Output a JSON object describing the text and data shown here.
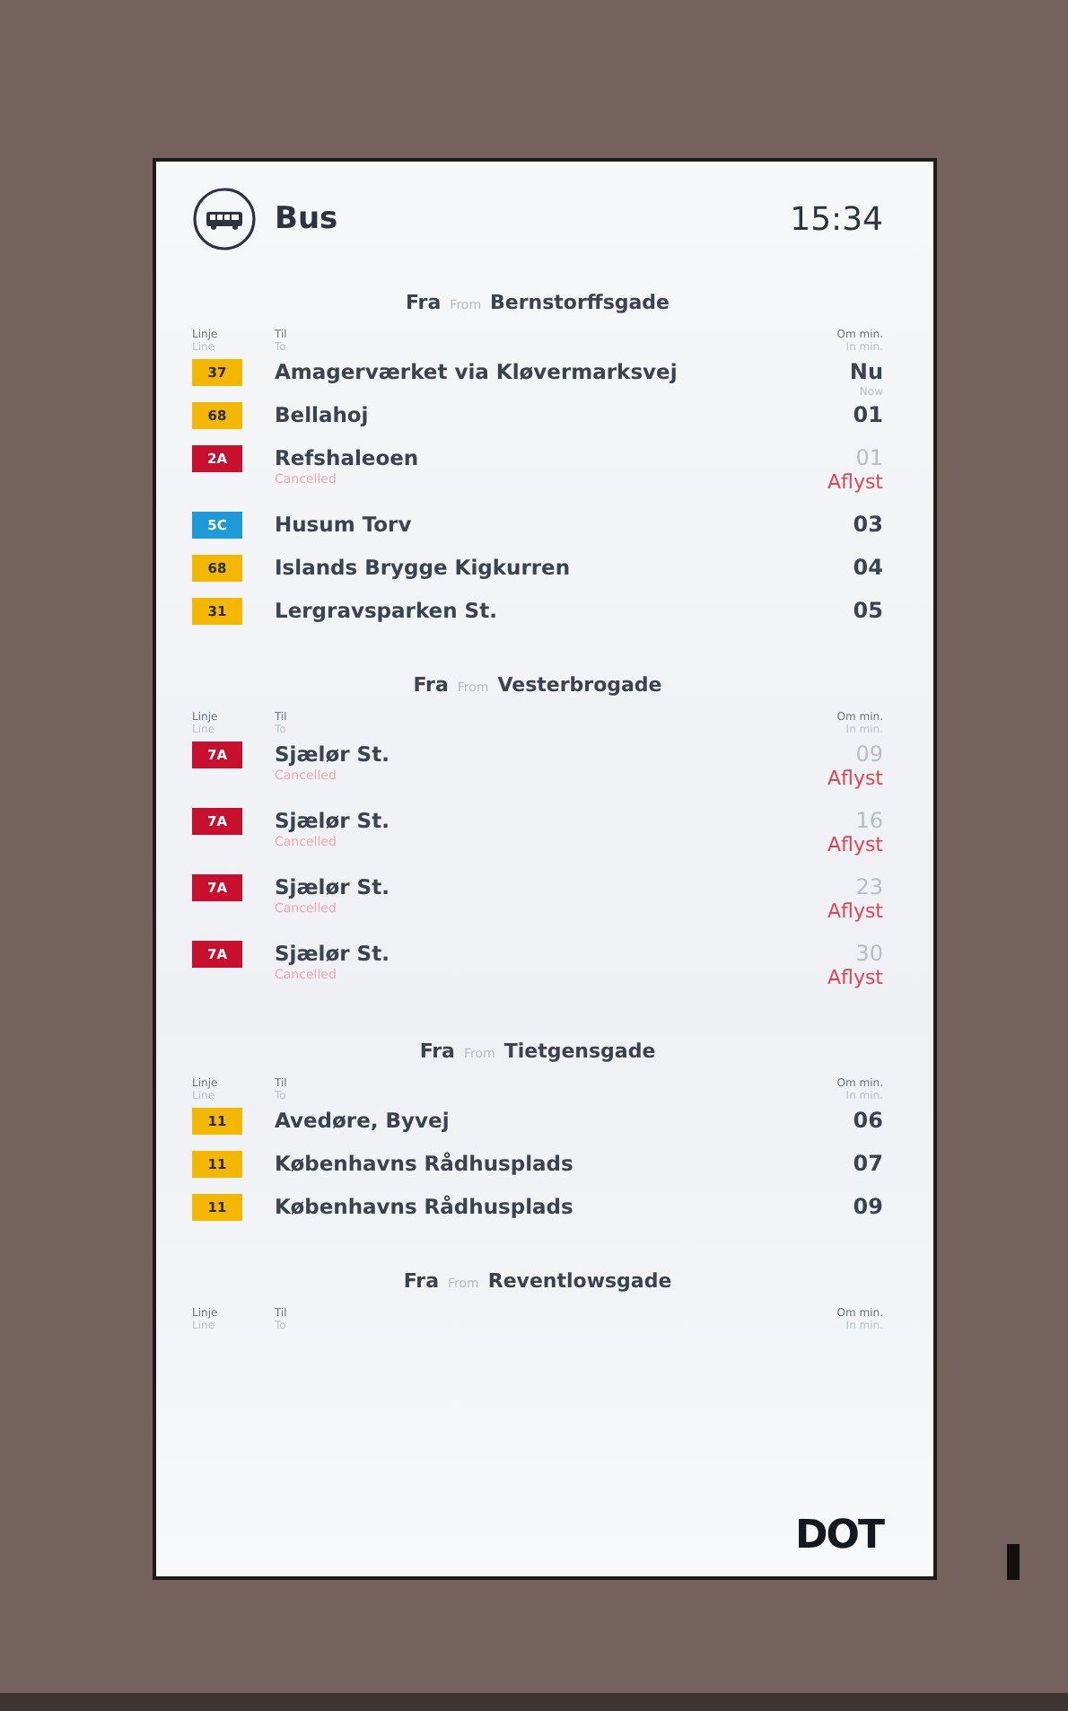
{
  "header": {
    "title": "Bus",
    "time": "15:34"
  },
  "sections": [
    {
      "from_label": "Fra",
      "from_label_en": "From",
      "stop": "Bernstorffsgade",
      "columns": {
        "line": "Linje",
        "line_en": "Line",
        "to": "Til",
        "to_en": "To",
        "minutes": "Om min.",
        "minutes_en": "In min."
      },
      "rows": [
        {
          "line": "37",
          "color": "#f5b800",
          "destination": "Amagerværket via Kløvermarksvej",
          "minutes": "Nu",
          "minutes_en": "Now",
          "cancelled": false
        },
        {
          "line": "68",
          "color": "#f5b800",
          "destination": "Bellahoj",
          "minutes": "01",
          "cancelled": false
        },
        {
          "line": "2A",
          "color": "#c8102e",
          "destination": "Refshaleoen",
          "minutes": "01",
          "cancelled": true,
          "note": "Cancelled",
          "status": "Aflyst"
        },
        {
          "line": "5C",
          "color": "#1e9ad6",
          "destination": "Husum Torv",
          "minutes": "03",
          "cancelled": false
        },
        {
          "line": "68",
          "color": "#f5b800",
          "destination": "Islands Brygge Kigkurren",
          "minutes": "04",
          "cancelled": false
        },
        {
          "line": "31",
          "color": "#f5b800",
          "destination": "Lergravsparken St.",
          "minutes": "05",
          "cancelled": false
        }
      ]
    },
    {
      "from_label": "Fra",
      "from_label_en": "From",
      "stop": "Vesterbrogade",
      "columns": {
        "line": "Linje",
        "line_en": "Line",
        "to": "Til",
        "to_en": "To",
        "minutes": "Om min.",
        "minutes_en": "In min."
      },
      "rows": [
        {
          "line": "7A",
          "color": "#c8102e",
          "destination": "Sjælør St.",
          "minutes": "09",
          "cancelled": true,
          "note": "Cancelled",
          "status": "Aflyst"
        },
        {
          "line": "7A",
          "color": "#c8102e",
          "destination": "Sjælør St.",
          "minutes": "16",
          "cancelled": true,
          "note": "Cancelled",
          "status": "Aflyst"
        },
        {
          "line": "7A",
          "color": "#c8102e",
          "destination": "Sjælør St.",
          "minutes": "23",
          "cancelled": true,
          "note": "Cancelled",
          "status": "Aflyst"
        },
        {
          "line": "7A",
          "color": "#c8102e",
          "destination": "Sjælør St.",
          "minutes": "30",
          "cancelled": true,
          "note": "Cancelled",
          "status": "Aflyst"
        }
      ]
    },
    {
      "from_label": "Fra",
      "from_label_en": "From",
      "stop": "Tietgensgade",
      "columns": {
        "line": "Linje",
        "line_en": "Line",
        "to": "Til",
        "to_en": "To",
        "minutes": "Om min.",
        "minutes_en": "In min."
      },
      "rows": [
        {
          "line": "11",
          "color": "#f5b800",
          "destination": "Avedøre, Byvej",
          "minutes": "06",
          "cancelled": false
        },
        {
          "line": "11",
          "color": "#f5b800",
          "destination": "Københavns Rådhusplads",
          "minutes": "07",
          "cancelled": false
        },
        {
          "line": "11",
          "color": "#f5b800",
          "destination": "Københavns Rådhusplads",
          "minutes": "09",
          "cancelled": false
        }
      ]
    },
    {
      "from_label": "Fra",
      "from_label_en": "From",
      "stop": "Reventlowsgade",
      "columns": {
        "line": "Linje",
        "line_en": "Line",
        "to": "Til",
        "to_en": "To",
        "minutes": "Om min.",
        "minutes_en": "In min."
      }
    }
  ],
  "logo": "DOT"
}
